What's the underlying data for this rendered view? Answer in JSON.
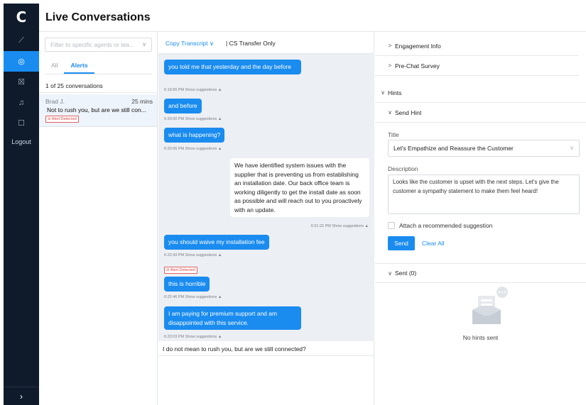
{
  "app": {
    "logo": "C",
    "page_title": "Live Conversations",
    "logout": "Logout",
    "expand_icon": "›"
  },
  "nav": [
    {
      "icon": "chart-icon",
      "glyph": "⟋",
      "active": false
    },
    {
      "icon": "chat-icon",
      "glyph": "◎",
      "active": true
    },
    {
      "icon": "box-icon",
      "glyph": "☒",
      "active": false
    },
    {
      "icon": "bell-icon",
      "glyph": "♫",
      "active": false
    },
    {
      "icon": "document-icon",
      "glyph": "☐",
      "active": false
    }
  ],
  "list": {
    "filter_placeholder": "Filter to specific agents or tea...",
    "tabs": [
      "All",
      "Alerts"
    ],
    "active_tab": "Alerts",
    "count": "1 of 25 conversations",
    "conversation": {
      "name": "Brad J.",
      "time": "25 mins",
      "snippet": "Not to rush you, but are we still con...",
      "alert": "⊘ Alert Detected"
    }
  },
  "transcript": {
    "copy_label": "Copy Transcript ∨",
    "transfer_label": "| CS Transfer Only",
    "messages": [
      {
        "from": "agent",
        "text": "you told me that yesterday and the day before",
        "meta": "6:19:56 PM Show suggestions ▲"
      },
      {
        "from": "agent",
        "text": "and before",
        "meta": "6:20:00 PM Show suggestions ▲"
      },
      {
        "from": "agent",
        "text": "what is happening?",
        "meta": "6:20:06 PM Show suggestions ▲"
      },
      {
        "from": "customer",
        "text": "We have identified system issues with the supplier that is preventing us from establishing an installation date. Our back office team is working diligently to get the install date as soon as possible and will reach out to you proactively with an update.",
        "meta": "6:21:22 PM Show suggestions ▲"
      },
      {
        "from": "agent",
        "text": "you should waive my installation fee",
        "meta": "6:22:43 PM Show suggestions ▲"
      },
      {
        "from": "agent",
        "text": "this is horrible",
        "meta": "6:22:46 PM Show suggestions ▲",
        "alert": "⊘ Alert Detected"
      },
      {
        "from": "agent",
        "text": "I am paying for premium support and am disappointed with this service.",
        "meta": "6:23:03 PM Show suggestions ▲"
      }
    ],
    "input_value": "I do not mean to rush you, but are we still connected?"
  },
  "hints": {
    "engagement_info": "Engagement Info",
    "pre_chat_survey": "Pre-Chat Survey",
    "hints_label": "Hints",
    "send_hint_label": "Send Hint",
    "title_label": "Title",
    "title_value": "Let's Empathize and Reassure the Customer",
    "description_label": "Description",
    "description_value": "Looks like the customer is upset with the next steps. Let's give the customer a sympathy statement to make them feel heard!",
    "attach_label": "Attach a recommended suggestion",
    "send_button": "Send",
    "clear_button": "Clear All",
    "sent_label": "Sent (0)",
    "empty_text": "No hints sent",
    "arrow_collapsed": ">",
    "arrow_expanded": "∨"
  },
  "colors": {
    "accent": "#1a8cf0",
    "rail": "#0f1b2b",
    "alert": "#e04040"
  }
}
